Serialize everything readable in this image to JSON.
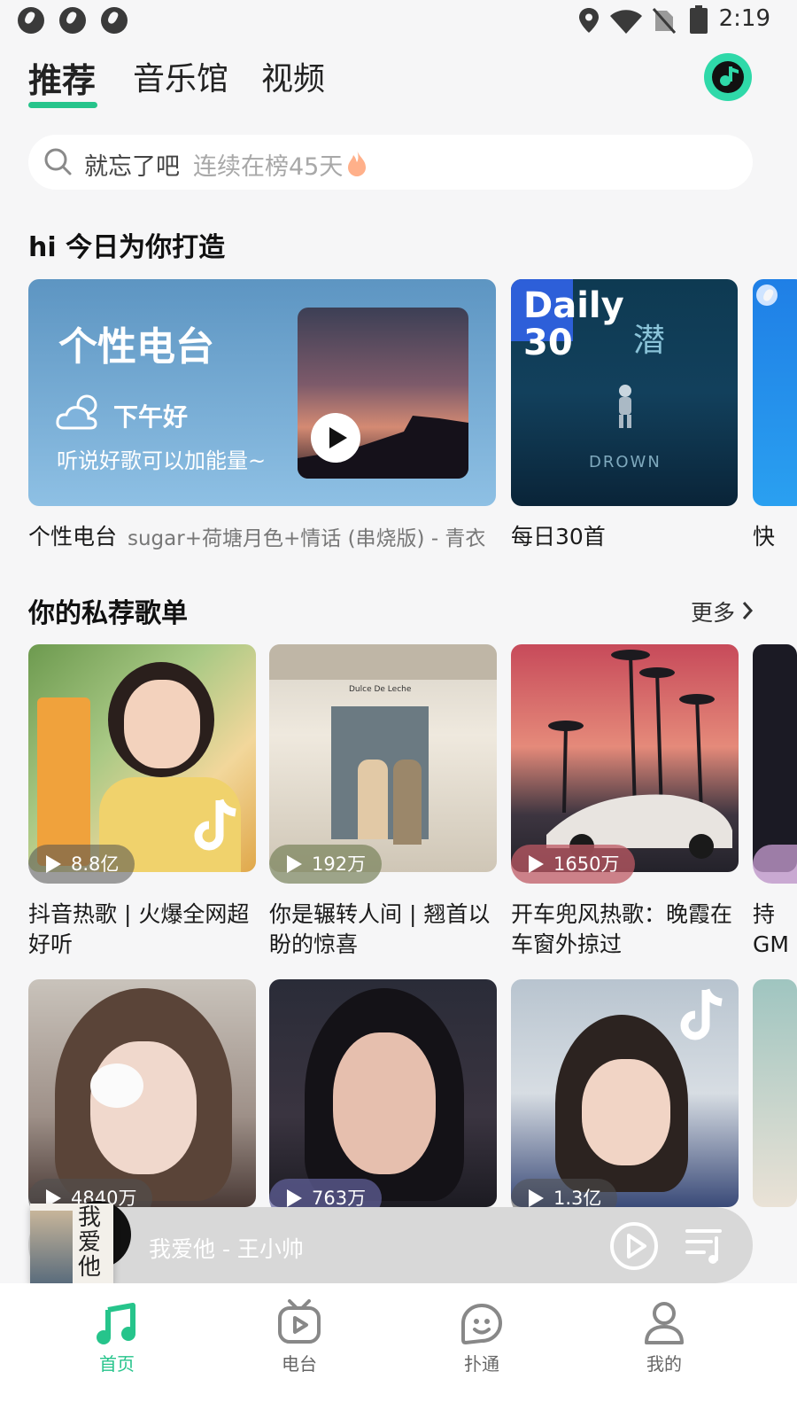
{
  "status_bar": {
    "time": "2:19",
    "icons": [
      "globe-icon",
      "globe-icon",
      "globe-icon",
      "location-icon",
      "wifi-icon",
      "no-sim-icon",
      "battery-icon"
    ]
  },
  "top_tabs": [
    {
      "label": "推荐",
      "active": true
    },
    {
      "label": "音乐馆",
      "active": false
    },
    {
      "label": "视频",
      "active": false
    }
  ],
  "search": {
    "keyword": "就忘了吧",
    "hint": "连续在榜45天"
  },
  "daily": {
    "title": "hi 今日为你打造",
    "radio": {
      "heading": "个性电台",
      "greeting": "下午好",
      "sub": "听说好歌可以加能量~",
      "caption": "个性电台",
      "caption_song": "sugar+荷塘月色+情话 (串烧版) - 青衣"
    },
    "daily30": {
      "logo_line1": "Daily",
      "logo_line2": "30",
      "cn_title": "潜",
      "en_title": "DROWN",
      "caption": "每日30首"
    },
    "third_caption": "快"
  },
  "playlists": {
    "title": "你的私荐歌单",
    "more": "更多",
    "row1": [
      {
        "count": "8.8亿",
        "title": "抖音热歌 | 火爆全网超好听"
      },
      {
        "count": "192万",
        "title": "你是辗转人间 | 翘首以盼的惊喜",
        "sign": "Dulce De Leche"
      },
      {
        "count": "1650万",
        "title": "开车兜风热歌：晚霞在车窗外掠过"
      },
      {
        "count": "",
        "title": "持GM"
      }
    ],
    "row2": [
      {
        "count": "4840万"
      },
      {
        "count": "763万"
      },
      {
        "count": "1.3亿"
      }
    ]
  },
  "mini_player": {
    "now_playing": "我爱他 - 王小帅",
    "cover_text": "我爱他"
  },
  "bottom_nav": [
    {
      "label": "首页",
      "active": true,
      "icon": "music-note-icon"
    },
    {
      "label": "电台",
      "active": false,
      "icon": "tv-radio-icon"
    },
    {
      "label": "扑通",
      "active": false,
      "icon": "chat-face-icon"
    },
    {
      "label": "我的",
      "active": false,
      "icon": "person-icon"
    }
  ],
  "colors": {
    "accent": "#26c48b",
    "background": "#f6f6f7"
  }
}
